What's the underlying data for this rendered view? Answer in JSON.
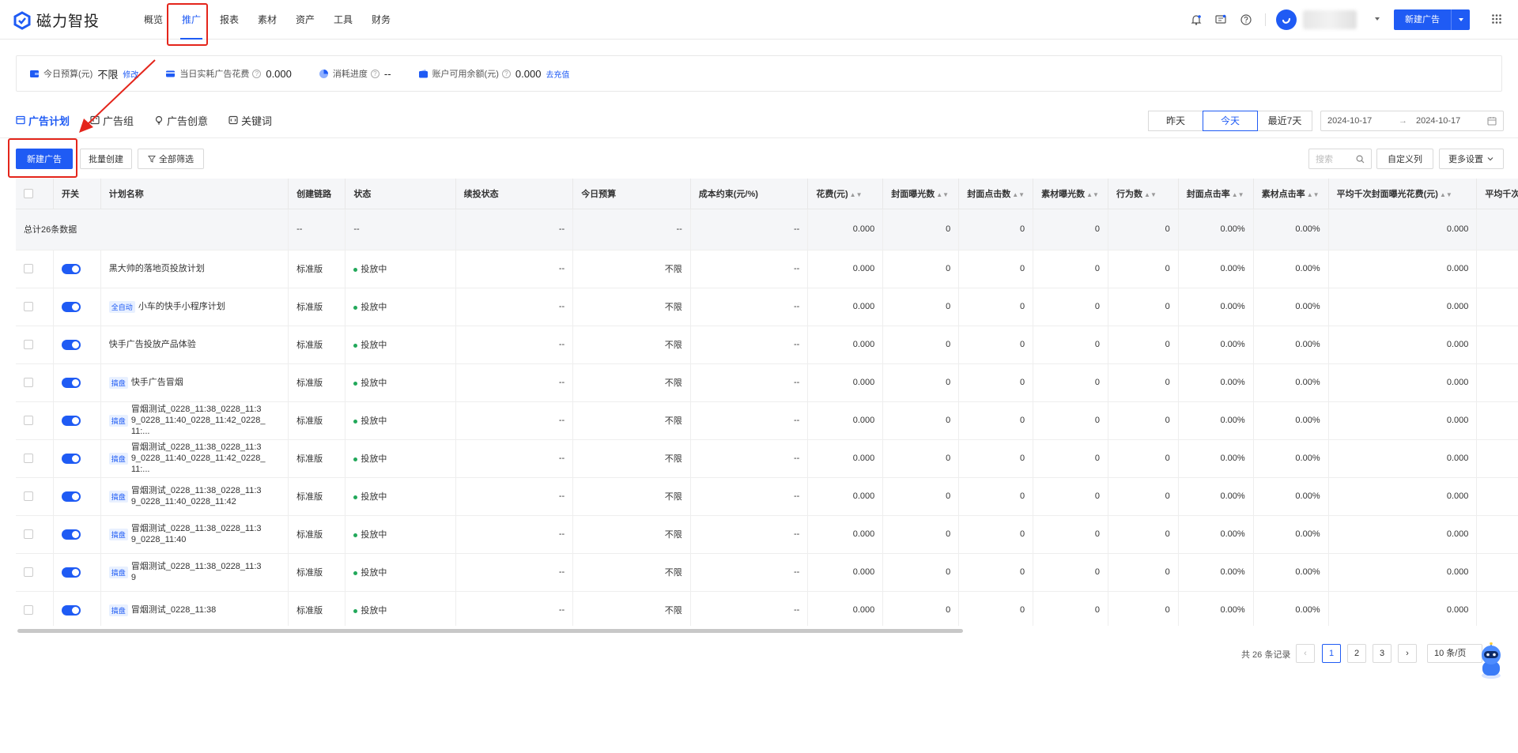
{
  "app": {
    "brand": "磁力智投",
    "accent": "#1f5bf4",
    "annotation_color": "#e4251b"
  },
  "nav": {
    "items": [
      {
        "label": "概览"
      },
      {
        "label": "推广"
      },
      {
        "label": "报表"
      },
      {
        "label": "素材"
      },
      {
        "label": "资产"
      },
      {
        "label": "工具"
      },
      {
        "label": "财务"
      }
    ],
    "active": "推广",
    "new_ad_label": "新建广告"
  },
  "summary": {
    "budget_label": "今日预算(元)",
    "budget_value": "不限",
    "budget_edit": "修改",
    "spend_label": "当日实耗广告花费",
    "spend_value": "0.000",
    "progress_label": "消耗进度",
    "progress_value": "--",
    "balance_label": "账户可用余额(元)",
    "balance_value": "0.000",
    "balance_link": "去充值"
  },
  "subtabs": [
    {
      "label": "广告计划"
    },
    {
      "label": "广告组"
    },
    {
      "label": "广告创意"
    },
    {
      "label": "关键词"
    }
  ],
  "daytabs": [
    {
      "label": "昨天"
    },
    {
      "label": "今天"
    },
    {
      "label": "最近7天"
    }
  ],
  "date_range": {
    "start": "2024-10-17",
    "sep": "→",
    "end": "2024-10-17"
  },
  "toolbar": {
    "new_ad": "新建广告",
    "batch_create": "批量创建",
    "filter_all": "全部筛选",
    "search_placeholder": "搜索",
    "custom_columns": "自定义列",
    "more_settings": "更多设置"
  },
  "table": {
    "headers": {
      "switch": "开关",
      "name": "计划名称",
      "chain": "创建链路",
      "status": "状态",
      "cont_status": "续投状态",
      "budget": "今日预算",
      "cost_limit": "成本约束(元/%)",
      "spend": "花费(元)",
      "cover_imp": "封面曝光数",
      "cover_click": "封面点击数",
      "mat_imp": "素材曝光数",
      "actions": "行为数",
      "cover_ctr": "封面点击率",
      "mat_ctr": "素材点击率",
      "cpm_cover": "平均千次封面曝光花费(元)",
      "cpm_mat": "平均千次素材曝"
    },
    "summary_row": {
      "label": "总计26条数据",
      "chain": "--",
      "status": "--",
      "cont_status": "--",
      "budget": "--",
      "cost_limit": "--",
      "spend": "0.000",
      "cover_imp": "0",
      "cover_click": "0",
      "mat_imp": "0",
      "actions": "0",
      "cover_ctr": "0.00%",
      "mat_ctr": "0.00%",
      "cpm_cover": "0.000"
    },
    "rows": [
      {
        "tag": "",
        "name": "黑大帅的落地页投放计划",
        "chain": "标准版",
        "status": "投放中",
        "cont_status": "--",
        "budget": "不限",
        "cost_limit": "--",
        "spend": "0.000",
        "cover_imp": "0",
        "cover_click": "0",
        "mat_imp": "0",
        "actions": "0",
        "cover_ctr": "0.00%",
        "mat_ctr": "0.00%",
        "cpm_cover": "0.000"
      },
      {
        "tag": "全自动",
        "name": "小车的快手小程序计划",
        "chain": "标准版",
        "status": "投放中",
        "cont_status": "--",
        "budget": "不限",
        "cost_limit": "--",
        "spend": "0.000",
        "cover_imp": "0",
        "cover_click": "0",
        "mat_imp": "0",
        "actions": "0",
        "cover_ctr": "0.00%",
        "mat_ctr": "0.00%",
        "cpm_cover": "0.000"
      },
      {
        "tag": "",
        "name": "快手广告投放产品体验",
        "chain": "标准版",
        "status": "投放中",
        "cont_status": "--",
        "budget": "不限",
        "cost_limit": "--",
        "spend": "0.000",
        "cover_imp": "0",
        "cover_click": "0",
        "mat_imp": "0",
        "actions": "0",
        "cover_ctr": "0.00%",
        "mat_ctr": "0.00%",
        "cpm_cover": "0.000"
      },
      {
        "tag": "搞盘",
        "name": "快手广告冒烟",
        "chain": "标准版",
        "status": "投放中",
        "cont_status": "--",
        "budget": "不限",
        "cost_limit": "--",
        "spend": "0.000",
        "cover_imp": "0",
        "cover_click": "0",
        "mat_imp": "0",
        "actions": "0",
        "cover_ctr": "0.00%",
        "mat_ctr": "0.00%",
        "cpm_cover": "0.000"
      },
      {
        "tag": "搞盘",
        "name": "冒烟测试_0228_11:38_0228_11:39_0228_11:40_0228_11:42_0228_11:...",
        "chain": "标准版",
        "status": "投放中",
        "cont_status": "--",
        "budget": "不限",
        "cost_limit": "--",
        "spend": "0.000",
        "cover_imp": "0",
        "cover_click": "0",
        "mat_imp": "0",
        "actions": "0",
        "cover_ctr": "0.00%",
        "mat_ctr": "0.00%",
        "cpm_cover": "0.000"
      },
      {
        "tag": "搞盘",
        "name": "冒烟测试_0228_11:38_0228_11:39_0228_11:40_0228_11:42_0228_11:...",
        "chain": "标准版",
        "status": "投放中",
        "cont_status": "--",
        "budget": "不限",
        "cost_limit": "--",
        "spend": "0.000",
        "cover_imp": "0",
        "cover_click": "0",
        "mat_imp": "0",
        "actions": "0",
        "cover_ctr": "0.00%",
        "mat_ctr": "0.00%",
        "cpm_cover": "0.000"
      },
      {
        "tag": "搞盘",
        "name": "冒烟测试_0228_11:38_0228_11:39_0228_11:40_0228_11:42",
        "chain": "标准版",
        "status": "投放中",
        "cont_status": "--",
        "budget": "不限",
        "cost_limit": "--",
        "spend": "0.000",
        "cover_imp": "0",
        "cover_click": "0",
        "mat_imp": "0",
        "actions": "0",
        "cover_ctr": "0.00%",
        "mat_ctr": "0.00%",
        "cpm_cover": "0.000"
      },
      {
        "tag": "搞盘",
        "name": "冒烟测试_0228_11:38_0228_11:39_0228_11:40",
        "chain": "标准版",
        "status": "投放中",
        "cont_status": "--",
        "budget": "不限",
        "cost_limit": "--",
        "spend": "0.000",
        "cover_imp": "0",
        "cover_click": "0",
        "mat_imp": "0",
        "actions": "0",
        "cover_ctr": "0.00%",
        "mat_ctr": "0.00%",
        "cpm_cover": "0.000"
      },
      {
        "tag": "搞盘",
        "name": "冒烟测试_0228_11:38_0228_11:39",
        "chain": "标准版",
        "status": "投放中",
        "cont_status": "--",
        "budget": "不限",
        "cost_limit": "--",
        "spend": "0.000",
        "cover_imp": "0",
        "cover_click": "0",
        "mat_imp": "0",
        "actions": "0",
        "cover_ctr": "0.00%",
        "mat_ctr": "0.00%",
        "cpm_cover": "0.000"
      },
      {
        "tag": "搞盘",
        "name": "冒烟测试_0228_11:38",
        "chain": "标准版",
        "status": "投放中",
        "cont_status": "--",
        "budget": "不限",
        "cost_limit": "--",
        "spend": "0.000",
        "cover_imp": "0",
        "cover_click": "0",
        "mat_imp": "0",
        "actions": "0",
        "cover_ctr": "0.00%",
        "mat_ctr": "0.00%",
        "cpm_cover": "0.000"
      }
    ]
  },
  "pagination": {
    "total_text": "共 26 条记录",
    "pages": [
      "1",
      "2",
      "3"
    ],
    "current": "1",
    "page_size": "10 条/页"
  }
}
